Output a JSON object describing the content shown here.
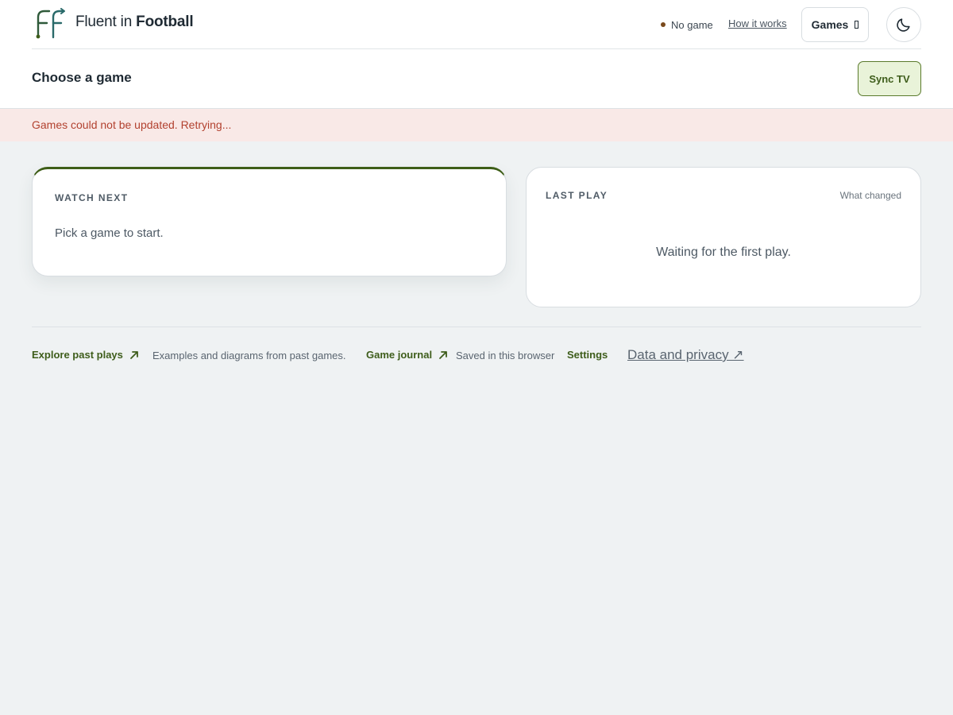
{
  "brand": {
    "name_light": "Fluent in",
    "name_bold": "Football",
    "logo_icon": "ff-logo-icon",
    "accent": "#3e5d1b"
  },
  "header": {
    "status_label": "No game",
    "how_it_works": "How it works",
    "games_button": "Games",
    "theme_icon": "moon-icon"
  },
  "subbar": {
    "title": "Choose a game",
    "sync_button": "Sync TV"
  },
  "alert": {
    "message": "Games could not be updated. Retrying...",
    "color": "#b2412f"
  },
  "watch_next": {
    "label": "WATCH NEXT",
    "body": "Pick a game to start."
  },
  "last_play": {
    "label": "LAST PLAY",
    "what_changed": "What changed",
    "empty_message": "Waiting for the first play."
  },
  "footer": {
    "explore_label": "Explore past plays",
    "explore_desc": "Examples and diagrams from past games.",
    "journal_label": "Game journal",
    "journal_desc": "Saved in this browser",
    "settings_label": "Settings",
    "privacy_label": "Data and privacy ↗"
  }
}
